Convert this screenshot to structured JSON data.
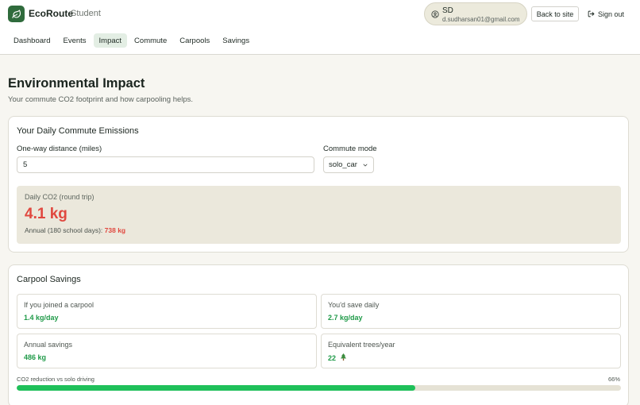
{
  "app": {
    "brand": "EcoRoute",
    "role": "Student"
  },
  "user": {
    "initials": "SD",
    "email": "d.sudharsan01@gmail.com"
  },
  "header": {
    "back_label": "Back to site",
    "signout_label": "Sign out"
  },
  "nav": {
    "items": [
      {
        "label": "Dashboard"
      },
      {
        "label": "Events"
      },
      {
        "label": "Impact"
      },
      {
        "label": "Commute"
      },
      {
        "label": "Carpools"
      },
      {
        "label": "Savings"
      }
    ],
    "active": "Impact"
  },
  "page": {
    "title": "Environmental Impact",
    "subtitle": "Your commute CO2 footprint and how carpooling helps."
  },
  "emissions": {
    "title": "Your Daily Commute Emissions",
    "distance_label": "One-way distance (miles)",
    "distance_value": "5",
    "mode_label": "Commute mode",
    "mode_value": "solo_car",
    "daily_label": "Daily CO2 (round trip)",
    "daily_value": "4.1 kg",
    "annual_prefix": "Annual (180 school days):",
    "annual_value": "738 kg"
  },
  "carpool": {
    "title": "Carpool Savings",
    "stats": [
      {
        "label": "If you joined a carpool",
        "value": "1.4 kg/day"
      },
      {
        "label": "You'd save daily",
        "value": "2.7 kg/day"
      },
      {
        "label": "Annual savings",
        "value": "486 kg"
      },
      {
        "label": "Equivalent trees/year",
        "value": "22"
      }
    ],
    "progress_label": "CO2 reduction vs solo driving",
    "progress_text": "66%",
    "progress_value": 0.66
  },
  "colors": {
    "brand": "#2f6b3c",
    "danger": "#e0483f",
    "success": "#1f9a48",
    "progress": "#1fc05a"
  },
  "icons": [
    "leaf-icon",
    "user-circle-icon",
    "sign-out-icon",
    "chevron-down-icon",
    "tree-icon"
  ]
}
